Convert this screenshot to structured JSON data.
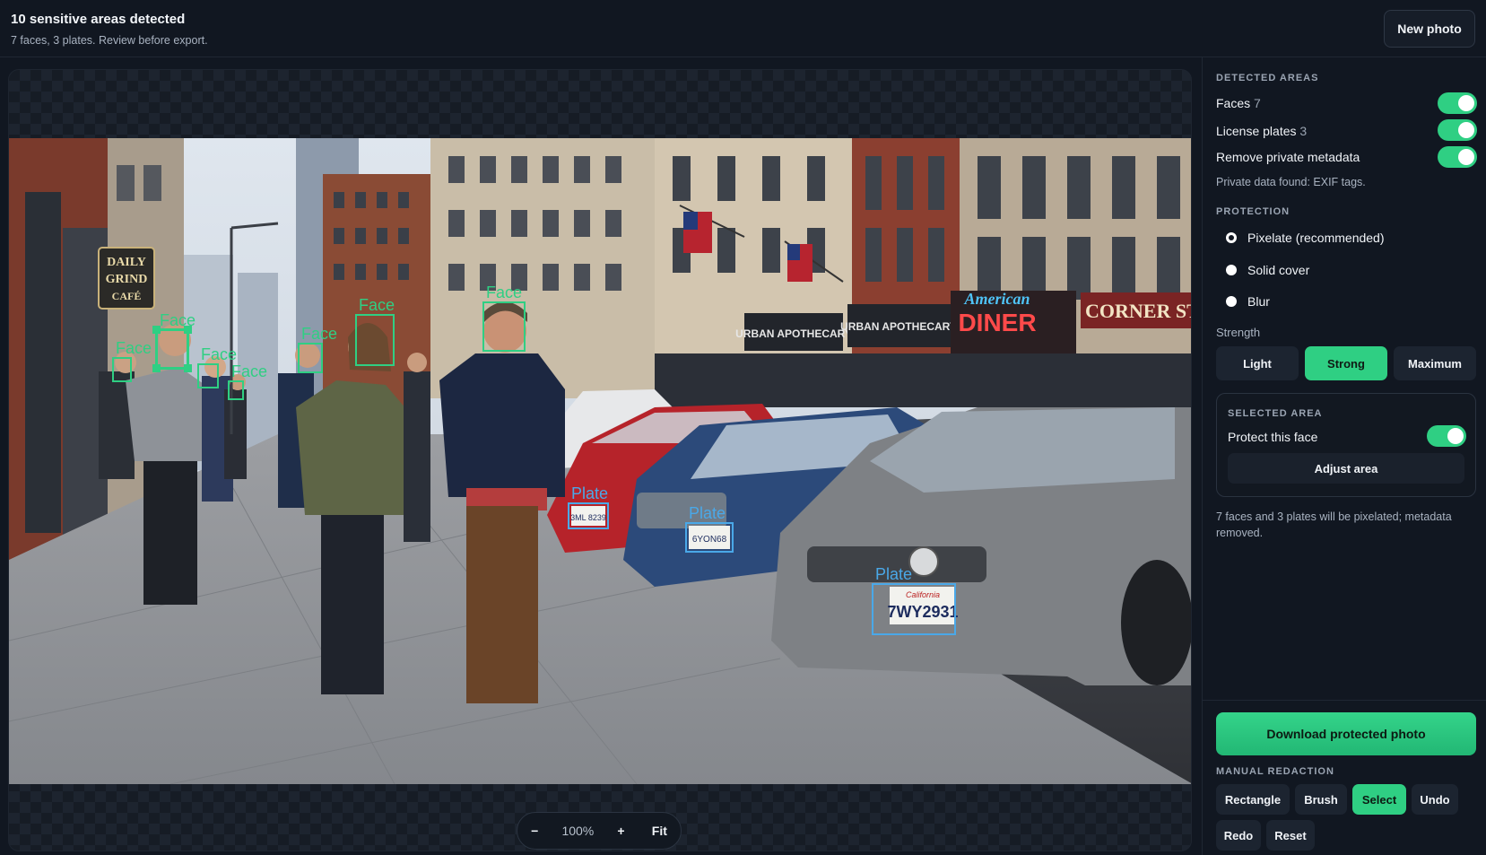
{
  "header": {
    "title": "10 sensitive areas detected",
    "subtitle": "7 faces, 3 plates. Review before export.",
    "new_photo_label": "New photo"
  },
  "canvas": {
    "face_label": "Face",
    "plate_label": "Plate",
    "sign_daily": "DAILY",
    "sign_grind": "GRIND",
    "sign_cafe": "CAFÉ",
    "sign_apothecary": "URBAN APOTHECARY",
    "sign_american": "American",
    "sign_diner": "DINER",
    "sign_corner": "CORNER STORE",
    "plate_1_text": "3ML 8239",
    "plate_2_text": "6YON68",
    "plate_3_text": "7WY2931",
    "plate_3_state": "California"
  },
  "zoom": {
    "minus": "−",
    "value": "100%",
    "plus": "+",
    "fit": "Fit"
  },
  "sidebar": {
    "detected_heading": "DETECTED AREAS",
    "faces_label": "Faces",
    "faces_count": "7",
    "plates_label": "License plates",
    "plates_count": "3",
    "metadata_label": "Remove private metadata",
    "metadata_note": "Private data found: EXIF tags.",
    "protection_heading": "PROTECTION",
    "protection_options": [
      "Pixelate (recommended)",
      "Solid cover",
      "Blur"
    ],
    "protection_selected": "Pixelate (recommended)",
    "strength_label": "Strength",
    "strength_options": [
      "Light",
      "Strong",
      "Maximum"
    ],
    "strength_selected": "Strong",
    "selected_heading": "SELECTED AREA",
    "protect_face_label": "Protect this face",
    "adjust_label": "Adjust area",
    "summary": "7 faces and 3 plates will be pixelated; metadata removed.",
    "download_label": "Download protected photo",
    "manual_heading": "MANUAL REDACTION",
    "tools": [
      "Rectangle",
      "Brush",
      "Select",
      "Undo",
      "Redo",
      "Reset"
    ],
    "tool_selected": "Select"
  },
  "colors": {
    "accent": "#2fcf83",
    "plate_box": "#4aa8e8",
    "background": "#111721"
  }
}
